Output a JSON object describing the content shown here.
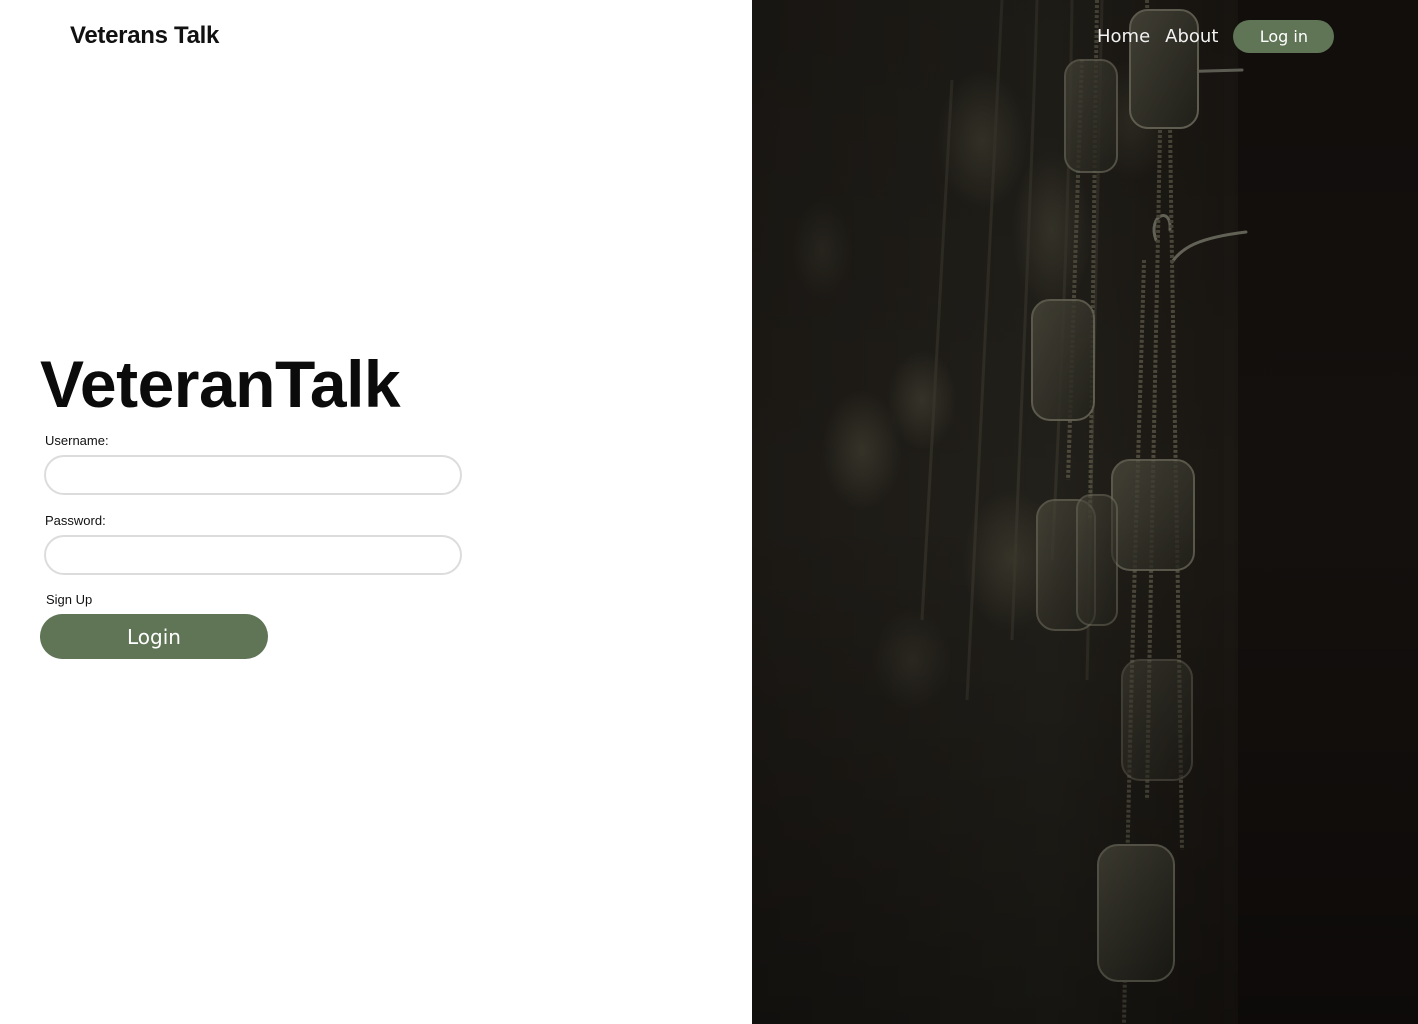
{
  "header": {
    "brand": "Veterans Talk",
    "nav": {
      "home": "Home",
      "about": "About",
      "login": "Log in"
    }
  },
  "main": {
    "title": "VeteranTalk",
    "form": {
      "username_label": "Username:",
      "username_value": "",
      "password_label": "Password:",
      "password_value": "",
      "signup_link": "Sign Up",
      "login_button": "Login"
    }
  },
  "hero_image": {
    "subject": "dog-tags-photo"
  },
  "colors": {
    "accent": "#5f7556",
    "background": "#ffffff",
    "photo_dark": "#1a1613"
  }
}
